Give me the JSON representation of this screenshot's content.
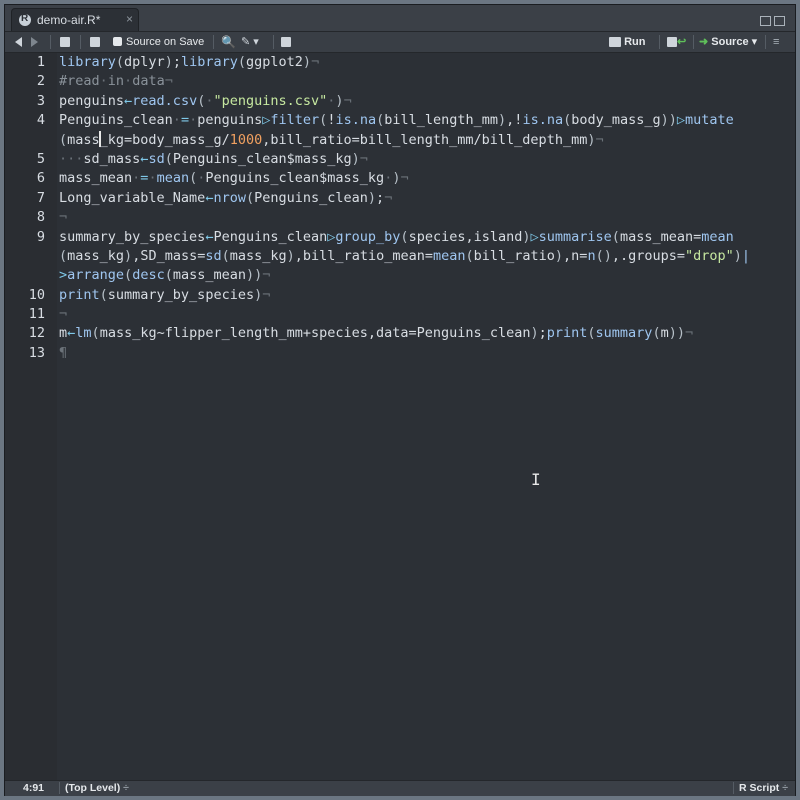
{
  "tab": {
    "title": "demo-air.R*",
    "close": "×"
  },
  "toolbar": {
    "source_on_save": "Source on Save",
    "run_label": "Run",
    "source_label": "Source",
    "source_caret": "▾"
  },
  "editor": {
    "line_numbers": [
      "1",
      "2",
      "3",
      "4",
      "",
      "5",
      "6",
      "7",
      "8",
      "9",
      "",
      "",
      "10",
      "11",
      "12",
      "13"
    ]
  },
  "status": {
    "position": "4:91",
    "scope": "(Top Level)",
    "scope_caret": "÷",
    "filetype": "R Script",
    "filetype_caret": "÷"
  }
}
